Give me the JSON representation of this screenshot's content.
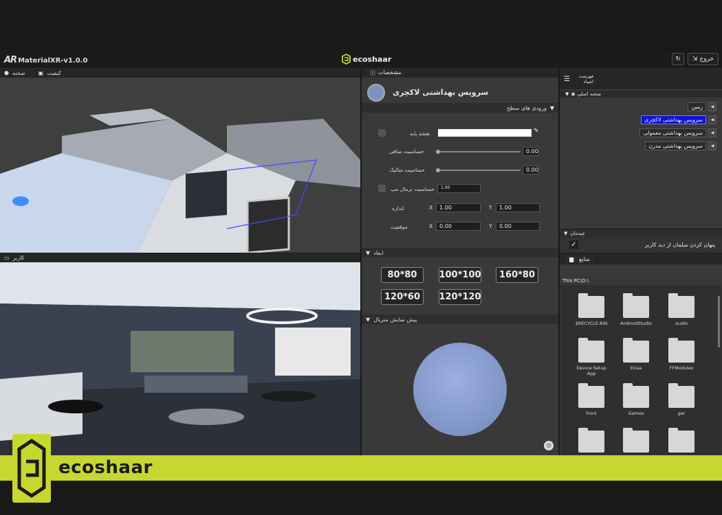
{
  "app": {
    "title": "MaterialXR-v1.0.0",
    "logo_text": "AR",
    "brand": "ecoshaar",
    "exit_label": "خروج"
  },
  "viewports": {
    "scene_label": "صحنه",
    "quality_label": "کیفیت",
    "user_label": "کاربر"
  },
  "properties": {
    "tab_label": "مشخصات",
    "material_name": "سرویس بهداشتی لاکچری",
    "surface_inputs_label": "ورودی های سطح",
    "base_map_label": "نقشه پایه",
    "smoothness_label": "حساسیت صافی",
    "smoothness_value": "0.00",
    "metallic_label": "حساسیت متالیک",
    "metallic_value": "0.00",
    "normal_map_label": "حساسیت نرمال مپ",
    "normal_map_value": "1.00",
    "size_label": "اندازه",
    "size_x": "1.00",
    "size_y": "1.00",
    "position_label": "موقعیت",
    "position_x": "0.00",
    "position_y": "0.00",
    "x_label": "X",
    "y_label": "Y",
    "dimensions_label": "ابعاد",
    "dimensions": [
      "80*80",
      "100*100",
      "160*80",
      "120*60",
      "120*120"
    ],
    "preview_label": "پیش نمایش متریال"
  },
  "hierarchy": {
    "tab_label": "فهرست اشیاء",
    "root_label": "صحنه اصلی",
    "items": [
      "زمین",
      "سرویس بهداشتی لاکچری",
      "سرویس بهداشتی معمولی",
      "سرویس بهداشتی مدرن"
    ]
  },
  "layout_section": {
    "label": "چیدمان",
    "hide_furniture_label": "پنهان کردن مبلمان از دید کاربر"
  },
  "resources": {
    "tab_label": "منابع",
    "path": "This PC\\D:\\",
    "folders": [
      "$RECYCLE.BIN",
      "AndroidStudio",
      "audio",
      "Device Setup App",
      "Eitaa",
      "FFModules",
      "front",
      "Games",
      "ger",
      "",
      "",
      ""
    ]
  },
  "banner": {
    "brand": "ecoshaar"
  },
  "colors": {
    "accent_banner": "#c7d730",
    "selected_item": "#1010d6",
    "panel_bg": "#393939"
  }
}
